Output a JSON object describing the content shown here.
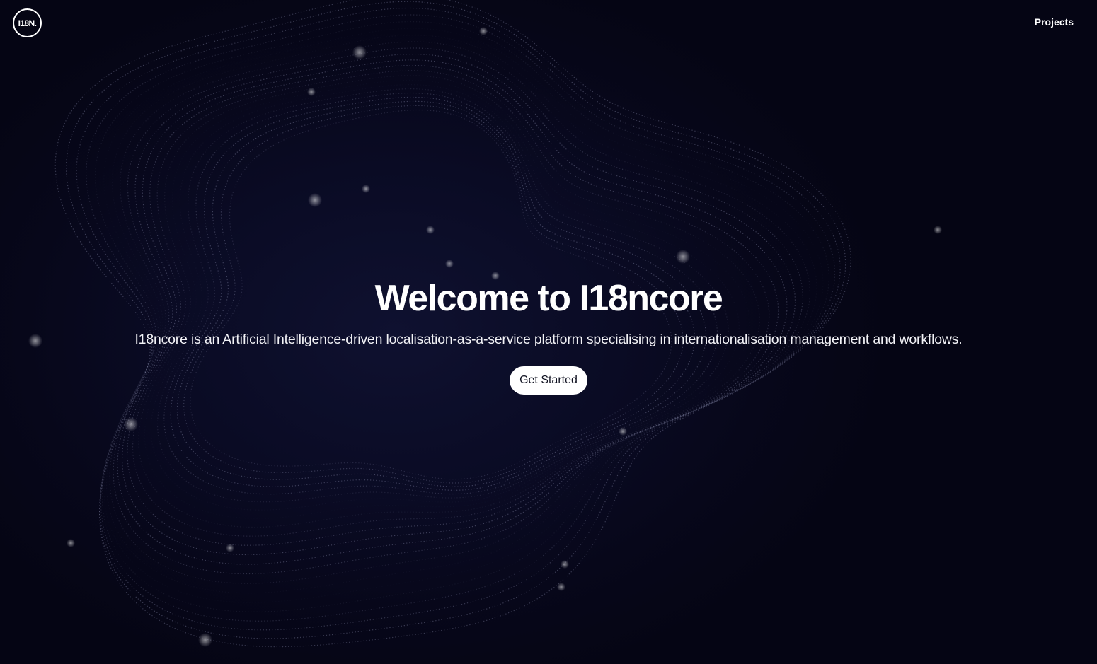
{
  "header": {
    "logo_text": "I18N.",
    "nav": {
      "projects_label": "Projects"
    }
  },
  "hero": {
    "title": "Welcome to I18ncore",
    "subtitle": "I18ncore is an Artificial Intelligence-driven localisation-as-a-service platform specialising in internationalisation management and workflows.",
    "cta_label": "Get Started"
  },
  "colors": {
    "background": "#06061a",
    "text": "#ffffff",
    "button_bg": "#ffffff",
    "button_text": "#111322"
  }
}
